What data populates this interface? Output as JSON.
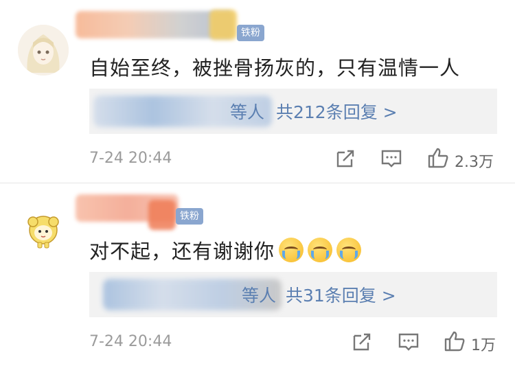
{
  "comments": [
    {
      "badge": "铁粉",
      "text": "自始至终，被挫骨扬灰的，只有温情一人",
      "reply_suffix_muted": "等人",
      "reply_link": "共212条回复 >",
      "time": "7-24 20:44",
      "likes": "2.3万",
      "icons": [
        "share-icon",
        "comment-icon",
        "like-icon"
      ]
    },
    {
      "badge": "铁粉",
      "text": "对不起，还有谢谢你",
      "emojis": [
        "crying-emoji",
        "crying-emoji",
        "crying-emoji"
      ],
      "reply_suffix_muted": "等人",
      "reply_link": "共31条回复 >",
      "time": "7-24 20:44",
      "likes": "1万",
      "icons": [
        "share-icon",
        "comment-icon",
        "like-icon"
      ]
    }
  ],
  "colors": {
    "badge": "#8aa6cf",
    "link": "#5b7fb1",
    "reply_bg": "#f2f2f2",
    "timestamp": "#9b9b9b"
  }
}
